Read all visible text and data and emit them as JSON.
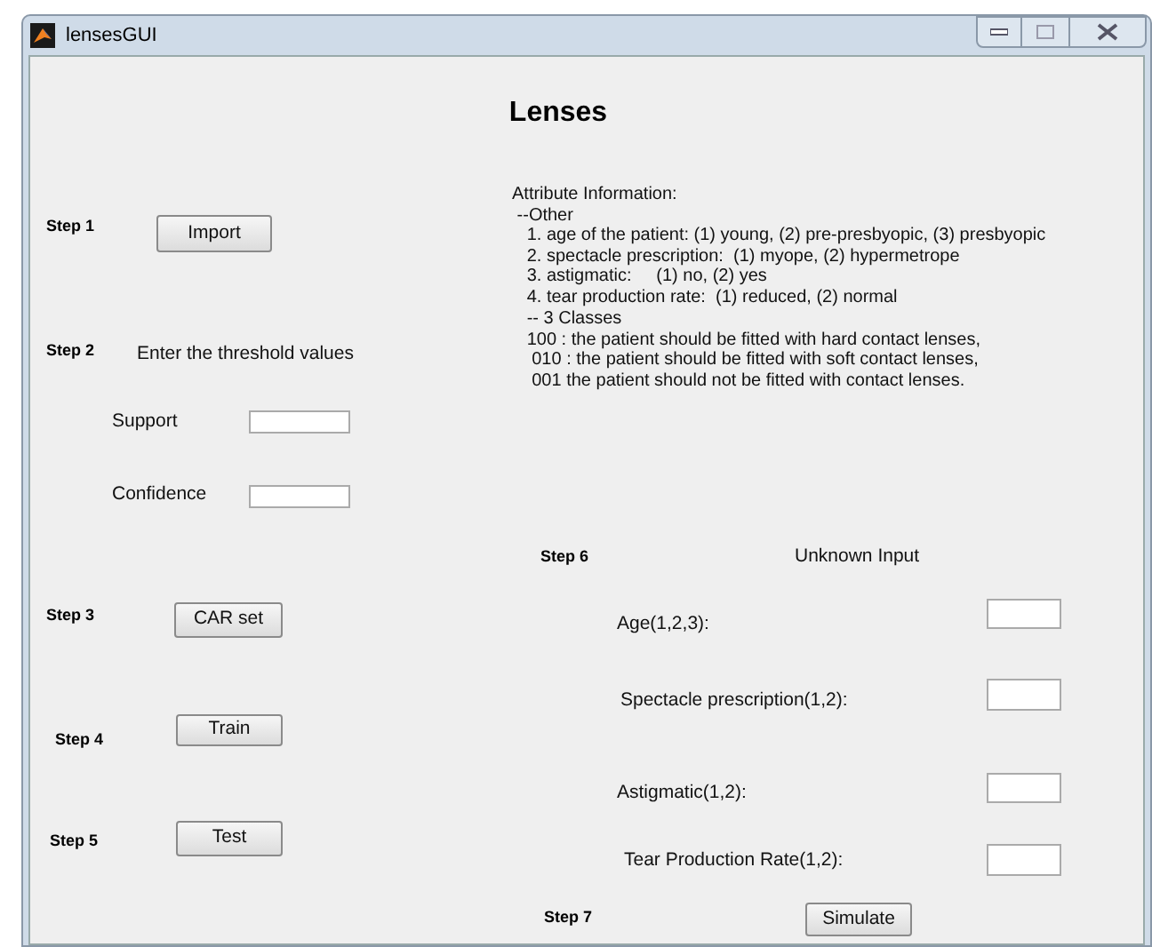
{
  "window": {
    "title": "lensesGUI"
  },
  "heading": "Lenses",
  "controls": [
    {
      "kind": "step",
      "text": "Step 1"
    },
    {
      "kind": "button",
      "text": "Import"
    },
    {
      "kind": "step",
      "text": "Step 2"
    },
    {
      "kind": "label",
      "text": "Enter the threshold values"
    },
    {
      "kind": "label",
      "text": "Support"
    },
    {
      "kind": "field"
    },
    {
      "kind": "label",
      "text": "Confidence"
    },
    {
      "kind": "field"
    },
    {
      "kind": "step",
      "text": "Step 3"
    },
    {
      "kind": "button",
      "text": "CAR set"
    },
    {
      "kind": "step",
      "text": "Step 4"
    },
    {
      "kind": "button",
      "text": "Train"
    },
    {
      "kind": "step",
      "text": "Step 5"
    },
    {
      "kind": "button",
      "text": "Test"
    },
    {
      "kind": "step",
      "text": "Step 6"
    },
    {
      "kind": "label",
      "text": "Unknown Input"
    },
    {
      "kind": "label",
      "text": "Age(1,2,3):"
    },
    {
      "kind": "field"
    },
    {
      "kind": "label",
      "text": "Spectacle prescription(1,2):"
    },
    {
      "kind": "field"
    },
    {
      "kind": "label",
      "text": "Astigmatic(1,2):"
    },
    {
      "kind": "field"
    },
    {
      "kind": "label",
      "text": "Tear Production Rate(1,2):"
    },
    {
      "kind": "field"
    },
    {
      "kind": "step",
      "text": "Step 7"
    },
    {
      "kind": "button",
      "text": "Simulate"
    }
  ],
  "attribute_info": [
    "Attribute Information:",
    " --Other",
    "   1. age of the patient: (1) young, (2) pre-presbyopic, (3) presbyopic",
    "   2. spectacle prescription:  (1) myope, (2) hypermetrope",
    "   3. astigmatic:     (1) no, (2) yes",
    "   4. tear production rate:  (1) reduced, (2) normal"
  ],
  "classes_info": [
    "   -- 3 Classes",
    "   100 : the patient should be fitted with hard contact lenses,",
    "    010 : the patient should be fitted with soft contact lenses,",
    "    001 the patient should not be fitted with contact lenses."
  ]
}
